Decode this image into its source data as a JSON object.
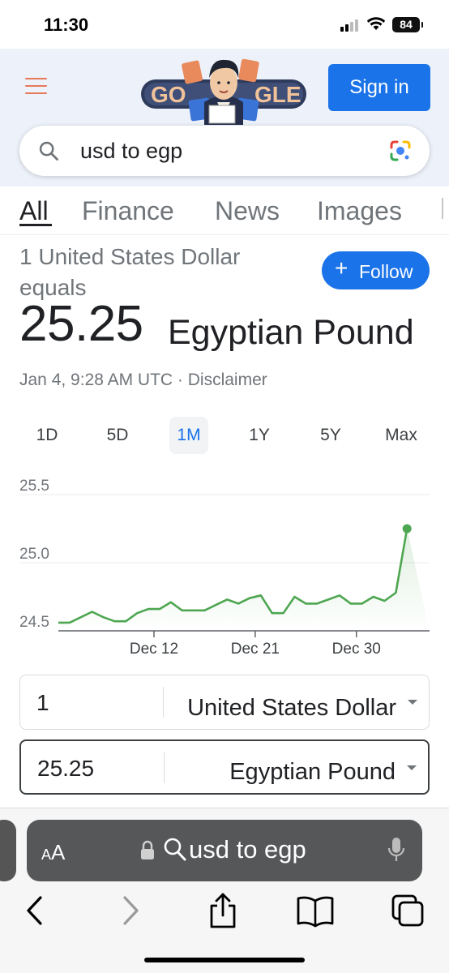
{
  "status_bar": {
    "time": "11:30",
    "battery": "84"
  },
  "header": {
    "doodle_text": "GOOGLE",
    "sign_in_label": "Sign in",
    "brand_color": "#1a73e8"
  },
  "search": {
    "query": "usd to egp",
    "search_icon": "search-icon",
    "lens_icon": "google-lens-icon"
  },
  "tabs": [
    {
      "label": "All",
      "active": true
    },
    {
      "label": "Finance",
      "active": false
    },
    {
      "label": "News",
      "active": false
    },
    {
      "label": "Images",
      "active": false
    }
  ],
  "converter_card": {
    "from_label": "1 United States Dollar equals",
    "rate": "25.25",
    "to_currency": "Egyptian Pound",
    "timestamp": "Jan 4, 9:28 AM UTC · Disclaimer",
    "follow_label": "Follow",
    "ranges": [
      "1D",
      "5D",
      "1M",
      "1Y",
      "5Y",
      "Max"
    ],
    "active_range": "1M"
  },
  "chart_data": {
    "type": "line",
    "title": "",
    "xlabel": "",
    "ylabel": "",
    "ylim": [
      24.5,
      25.5
    ],
    "y_ticks": [
      "25.5",
      "25.0",
      "24.5"
    ],
    "x_ticks": [
      "Dec 12",
      "Dec 21",
      "Dec 30"
    ],
    "x_tick_positions": [
      9.5,
      18.5,
      27.5
    ],
    "x": [
      1,
      2,
      3,
      4,
      5,
      6,
      7,
      8,
      9,
      10,
      11,
      12,
      13,
      14,
      15,
      16,
      17,
      18,
      19,
      20,
      21,
      22,
      23,
      24,
      25,
      26,
      27,
      28,
      29,
      30,
      31,
      32,
      33,
      34
    ],
    "series": [
      {
        "values": [
          24.56,
          24.56,
          24.6,
          24.64,
          24.6,
          24.57,
          24.57,
          24.63,
          24.66,
          24.66,
          24.71,
          24.65,
          24.65,
          24.65,
          24.69,
          24.73,
          24.7,
          24.74,
          24.76,
          24.63,
          24.63,
          24.75,
          24.7,
          24.7,
          24.73,
          24.76,
          24.7,
          24.7,
          24.75,
          24.72,
          24.78,
          25.25
        ],
        "color": "#4ea651"
      }
    ],
    "grid": true,
    "legend": "none"
  },
  "currency_converter": {
    "from_amount": "1",
    "from_currency": "United States Dollar",
    "to_amount": "25.25",
    "to_currency": "Egyptian Pound"
  },
  "safari": {
    "aa_label": "A",
    "aa_small": "A",
    "address": "usd to egp"
  }
}
